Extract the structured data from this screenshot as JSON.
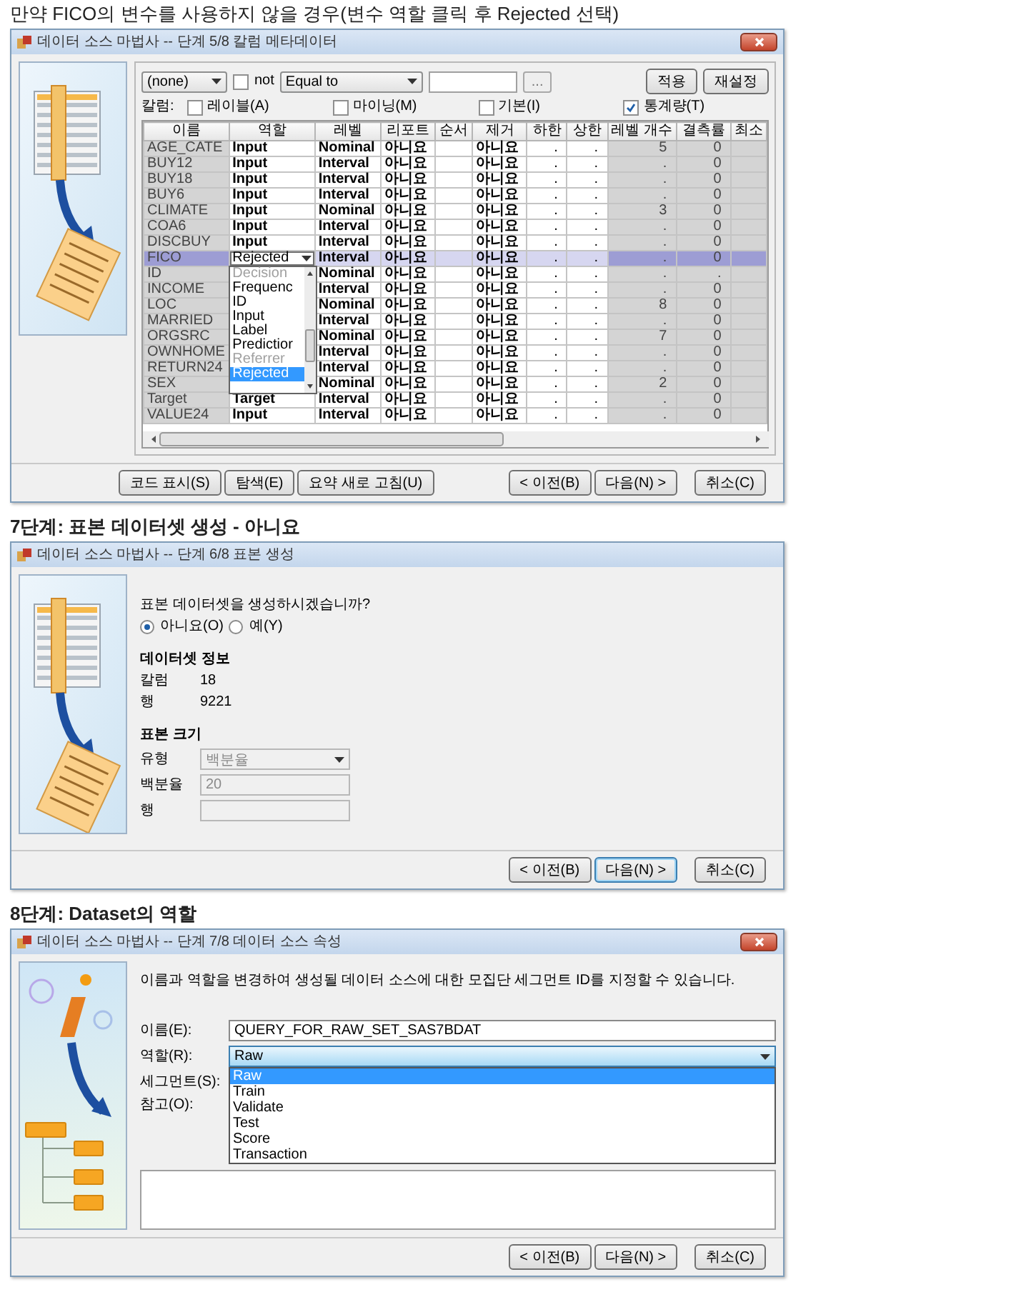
{
  "sections": [
    {
      "heading": {
        "text": "만약 FICO의 변수를 사용하지 않을 경우(변수 역할 클릭 후 Rejected 선택)",
        "bold": false
      },
      "dialog": {
        "kind": "column_metadata",
        "title": "데이터 소스 마법사 -- 단계 5/8 칼럼 메타데이터",
        "close_button": true,
        "filter": {
          "column_select": "(none)",
          "not_checked": false,
          "not_label": "not",
          "operator_select": "Equal to",
          "browse_button": "...",
          "buttons": [
            "적용",
            "재설정"
          ]
        },
        "column_toggles": {
          "label": "칼럼:",
          "items": [
            {
              "label": "레이블(A)",
              "checked": false
            },
            {
              "label": "마이닝(M)",
              "checked": false
            },
            {
              "label": "기본(I)",
              "checked": false
            },
            {
              "label": "통계량(T)",
              "checked": true
            }
          ]
        },
        "table": {
          "columns": [
            {
              "label": "이름",
              "read_only": true
            },
            {
              "label": "역할",
              "read_only": false
            },
            {
              "label": "레벨",
              "read_only": false
            },
            {
              "label": "리포트",
              "read_only": false
            },
            {
              "label": "순서",
              "read_only": false
            },
            {
              "label": "제거",
              "read_only": false
            },
            {
              "label": "하한",
              "read_only": false
            },
            {
              "label": "상한",
              "read_only": false
            },
            {
              "label": "레벨 개수",
              "read_only": true
            },
            {
              "label": "결측률",
              "read_only": true
            },
            {
              "label": "최소",
              "read_only": true
            }
          ],
          "rows": [
            {
              "name": "AGE_CATE",
              "role": "Input",
              "level": "Nominal",
              "report": "아니요",
              "drop": "아니요",
              "lower": ".",
              "upper": ".",
              "level_count": "5",
              "missing": "0",
              "selected": false
            },
            {
              "name": "BUY12",
              "role": "Input",
              "level": "Interval",
              "report": "아니요",
              "drop": "아니요",
              "lower": ".",
              "upper": ".",
              "level_count": ".",
              "missing": "0",
              "selected": false
            },
            {
              "name": "BUY18",
              "role": "Input",
              "level": "Interval",
              "report": "아니요",
              "drop": "아니요",
              "lower": ".",
              "upper": ".",
              "level_count": ".",
              "missing": "0",
              "selected": false
            },
            {
              "name": "BUY6",
              "role": "Input",
              "level": "Interval",
              "report": "아니요",
              "drop": "아니요",
              "lower": ".",
              "upper": ".",
              "level_count": ".",
              "missing": "0",
              "selected": false
            },
            {
              "name": "CLIMATE",
              "role": "Input",
              "level": "Nominal",
              "report": "아니요",
              "drop": "아니요",
              "lower": ".",
              "upper": ".",
              "level_count": "3",
              "missing": "0",
              "selected": false
            },
            {
              "name": "COA6",
              "role": "Input",
              "level": "Interval",
              "report": "아니요",
              "drop": "아니요",
              "lower": ".",
              "upper": ".",
              "level_count": ".",
              "missing": "0",
              "selected": false
            },
            {
              "name": "DISCBUY",
              "role": "Input",
              "level": "Interval",
              "report": "아니요",
              "drop": "아니요",
              "lower": ".",
              "upper": ".",
              "level_count": ".",
              "missing": "0",
              "selected": false
            },
            {
              "name": "FICO",
              "role": "Rejected",
              "level": "Interval",
              "report": "아니요",
              "drop": "아니요",
              "lower": ".",
              "upper": ".",
              "level_count": ".",
              "missing": "0",
              "selected": true,
              "role_menu": {
                "items": [
                  {
                    "label": "Decision",
                    "disabled": true,
                    "selected": false
                  },
                  {
                    "label": "Frequenc",
                    "disabled": false,
                    "selected": false
                  },
                  {
                    "label": "ID",
                    "disabled": false,
                    "selected": false
                  },
                  {
                    "label": "Input",
                    "disabled": false,
                    "selected": false
                  },
                  {
                    "label": "Label",
                    "disabled": false,
                    "selected": false
                  },
                  {
                    "label": "Predictior",
                    "disabled": false,
                    "selected": false
                  },
                  {
                    "label": "Referrer",
                    "disabled": true,
                    "selected": false
                  },
                  {
                    "label": "Rejected",
                    "disabled": false,
                    "selected": true
                  }
                ]
              }
            },
            {
              "name": "ID",
              "level": "Nominal",
              "report": "아니요",
              "drop": "아니요",
              "lower": ".",
              "upper": ".",
              "level_count": ".",
              "missing": ".",
              "selected": false
            },
            {
              "name": "INCOME",
              "level": "Interval",
              "report": "아니요",
              "drop": "아니요",
              "lower": ".",
              "upper": ".",
              "level_count": ".",
              "missing": "0",
              "selected": false
            },
            {
              "name": "LOC",
              "level": "Nominal",
              "report": "아니요",
              "drop": "아니요",
              "lower": ".",
              "upper": ".",
              "level_count": "8",
              "missing": "0",
              "selected": false
            },
            {
              "name": "MARRIED",
              "level": "Interval",
              "report": "아니요",
              "drop": "아니요",
              "lower": ".",
              "upper": ".",
              "level_count": ".",
              "missing": "0",
              "selected": false
            },
            {
              "name": "ORGSRC",
              "level": "Nominal",
              "report": "아니요",
              "drop": "아니요",
              "lower": ".",
              "upper": ".",
              "level_count": "7",
              "missing": "0",
              "selected": false
            },
            {
              "name": "OWNHOME",
              "level": "Interval",
              "report": "아니요",
              "drop": "아니요",
              "lower": ".",
              "upper": ".",
              "level_count": ".",
              "missing": "0",
              "selected": false
            },
            {
              "name": "RETURN24",
              "level": "Interval",
              "report": "아니요",
              "drop": "아니요",
              "lower": ".",
              "upper": ".",
              "level_count": ".",
              "missing": "0",
              "selected": false
            },
            {
              "name": "SEX",
              "level": "Nominal",
              "report": "아니요",
              "drop": "아니요",
              "lower": ".",
              "upper": ".",
              "level_count": "2",
              "missing": "0",
              "selected": false
            },
            {
              "name": "Target",
              "role": "Target",
              "level": "Interval",
              "report": "아니요",
              "drop": "아니요",
              "lower": ".",
              "upper": ".",
              "level_count": ".",
              "missing": "0",
              "selected": false
            },
            {
              "name": "VALUE24",
              "role": "Input",
              "level": "Interval",
              "report": "아니요",
              "drop": "아니요",
              "lower": ".",
              "upper": ".",
              "level_count": ".",
              "missing": "0",
              "selected": false
            }
          ]
        },
        "button_groups": [
          [
            {
              "label": "코드 표시(S)",
              "focused": false
            },
            {
              "label": "탐색(E)",
              "focused": false
            },
            {
              "label": "요약 새로 고침(U)",
              "focused": false
            }
          ],
          [
            {
              "label": "< 이전(B)",
              "focused": false
            },
            {
              "label": "다음(N) >",
              "focused": false
            }
          ],
          [
            {
              "label": "취소(C)",
              "focused": false
            }
          ]
        ]
      }
    },
    {
      "heading": {
        "text": "7단계: 표본 데이터셋 생성 - 아니요",
        "bold": true
      },
      "dialog": {
        "kind": "sample",
        "title": "데이터 소스 마법사 -- 단계 6/8 표본 생성",
        "close_button": false,
        "question": "표본 데이터셋을 생성하시겠습니까?",
        "options": [
          {
            "label": "아니요(O)",
            "selected": true
          },
          {
            "label": "예(Y)",
            "selected": false
          }
        ],
        "info_heading": "데이터셋 정보",
        "info": [
          {
            "label": "칼럼",
            "value": "18"
          },
          {
            "label": "행",
            "value": "9221"
          }
        ],
        "size_heading": "표본 크기",
        "size_fields": [
          {
            "kind": "select",
            "label": "유형",
            "value": "백분율",
            "disabled": true
          },
          {
            "kind": "text",
            "label": "백분율",
            "value": "20",
            "disabled": true
          },
          {
            "kind": "text",
            "label": "행",
            "disabled": true
          }
        ],
        "button_groups": [
          [
            {
              "label": "< 이전(B)",
              "focused": false
            },
            {
              "label": "다음(N) >",
              "focused": true
            }
          ],
          [
            {
              "label": "취소(C)",
              "focused": false
            }
          ]
        ]
      }
    },
    {
      "heading": {
        "text": "8단계: Dataset의 역할",
        "bold": true
      },
      "dialog": {
        "kind": "properties",
        "title": "데이터 소스 마법사 -- 단계 7/8 데이터 소스 속성",
        "close_button": true,
        "description": "이름과 역할을 변경하여 생성될 데이터 소스에 대한 모집단 세그먼트 ID를 지정할 수 있습니다.",
        "fields": [
          {
            "kind": "text",
            "label": "이름(E):",
            "value": "QUERY_FOR_RAW_SET_SAS7BDAT"
          },
          {
            "kind": "combo",
            "label": "역할(R):",
            "value": "Raw",
            "options": [
              {
                "label": "Raw",
                "selected": true
              },
              {
                "label": "Train",
                "selected": false
              },
              {
                "label": "Validate",
                "selected": false
              },
              {
                "label": "Test",
                "selected": false
              },
              {
                "label": "Score",
                "selected": false
              },
              {
                "label": "Transaction",
                "selected": false
              }
            ]
          },
          {
            "kind": "covered",
            "label": "세그먼트(S):"
          },
          {
            "kind": "textarea",
            "label": "참고(O):"
          }
        ],
        "button_groups": [
          [
            {
              "label": "< 이전(B)",
              "focused": false
            },
            {
              "label": "다음(N) >",
              "focused": false
            }
          ],
          [
            {
              "label": "취소(C)",
              "focused": false
            }
          ]
        ]
      }
    }
  ]
}
